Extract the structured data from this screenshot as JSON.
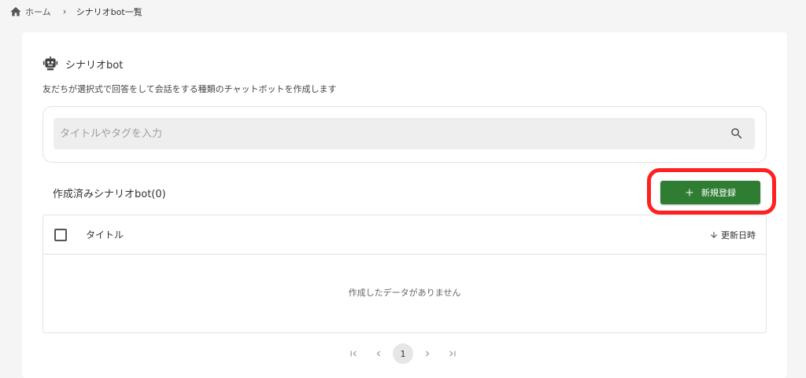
{
  "breadcrumb": {
    "home_label": "ホーム",
    "current_label": "シナリオbot一覧"
  },
  "page": {
    "title": "シナリオbot",
    "description": "友だちが選択式で回答をして会話をする種類のチャットボットを作成します"
  },
  "search": {
    "placeholder": "タイトルやタグを入力",
    "value": ""
  },
  "list": {
    "created_label": "作成済みシナリオbot(0)",
    "new_button_label": "新規登録",
    "columns": {
      "title": "タイトル",
      "updated": "更新日時"
    },
    "empty_message": "作成したデータがありません"
  },
  "pagination": {
    "current_page": "1"
  },
  "colors": {
    "primary_green": "#2e7d32",
    "highlight_red": "#ff2020",
    "background": "#f5f5f5"
  },
  "icons": {
    "home": "home-icon",
    "breadcrumb_separator": "chevron-right-icon",
    "bot": "robot-icon",
    "search": "search-icon",
    "add": "plus-icon",
    "sort": "arrow-down-icon",
    "first_page": "first-page-icon",
    "prev_page": "chevron-left-icon",
    "next_page": "chevron-right-icon",
    "last_page": "last-page-icon"
  }
}
